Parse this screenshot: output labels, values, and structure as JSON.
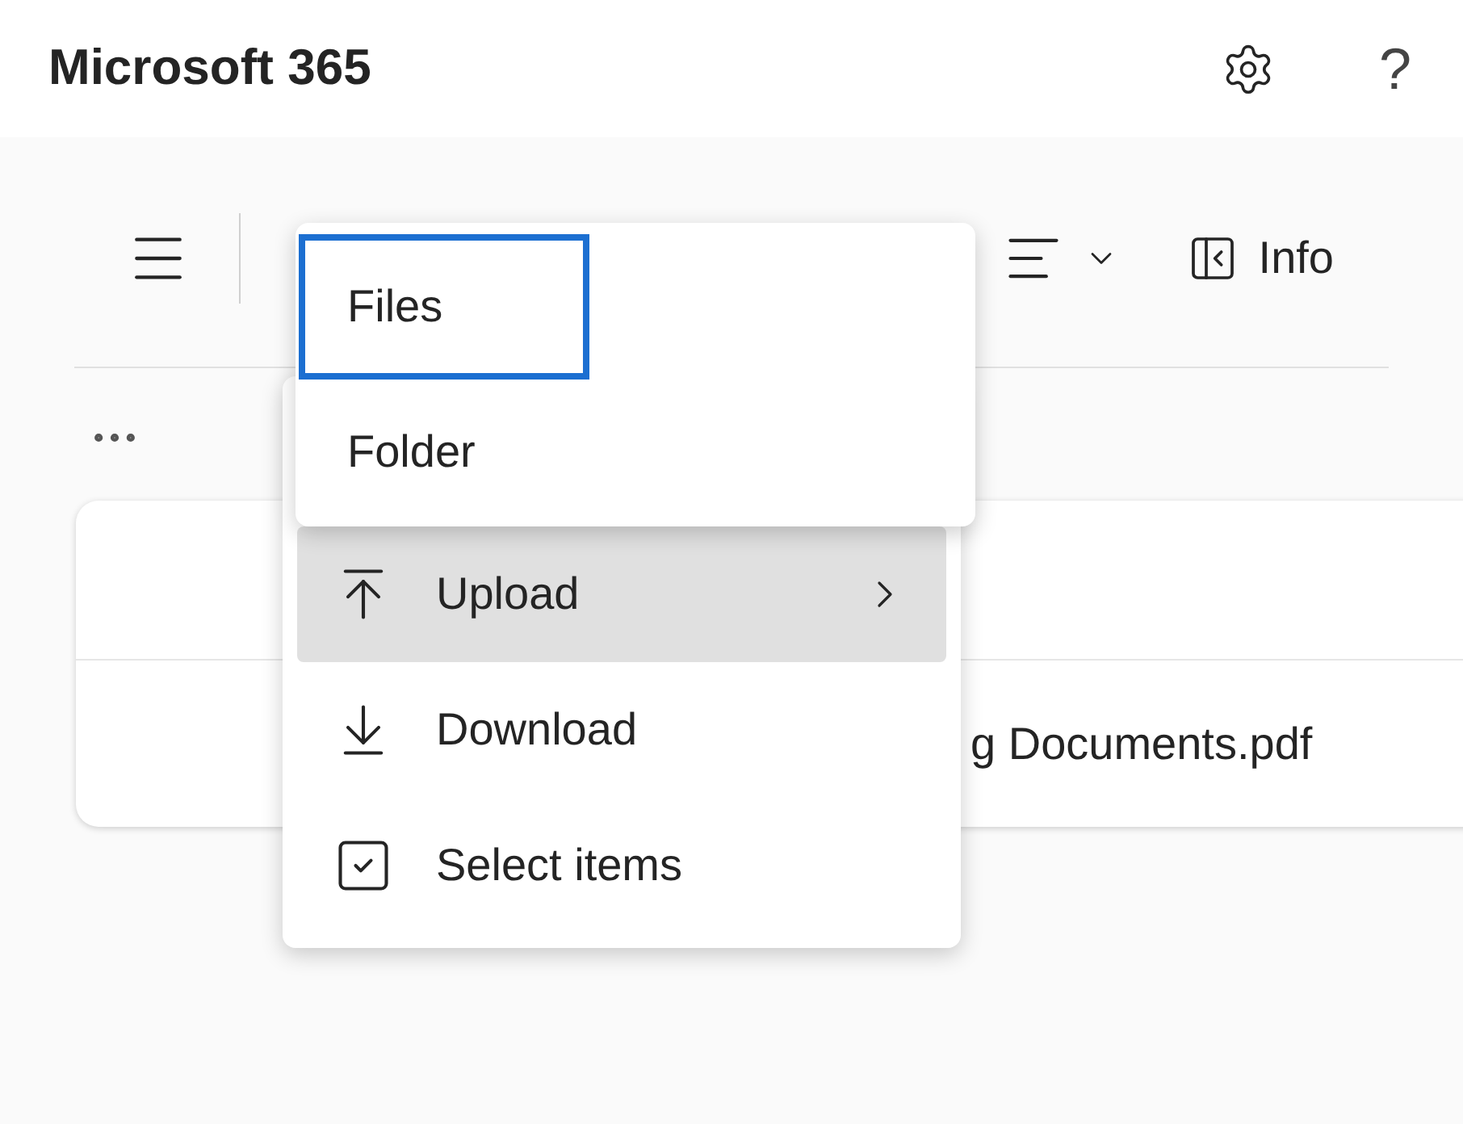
{
  "header": {
    "title": "Microsoft 365",
    "help_glyph": "?"
  },
  "toolbar": {
    "info_label": "Info"
  },
  "files": [
    {
      "name": "g Documents.pdf"
    }
  ],
  "menu": {
    "items": [
      {
        "kind": "upload",
        "label": "Upload",
        "selected": true,
        "has_submenu": true
      },
      {
        "kind": "download",
        "label": "Download",
        "selected": false,
        "has_submenu": false
      },
      {
        "kind": "select",
        "label": "Select items",
        "selected": false,
        "has_submenu": false
      }
    ]
  },
  "submenu": {
    "items": [
      {
        "label": "Files",
        "focused": true
      },
      {
        "label": "Folder",
        "focused": false
      }
    ]
  }
}
